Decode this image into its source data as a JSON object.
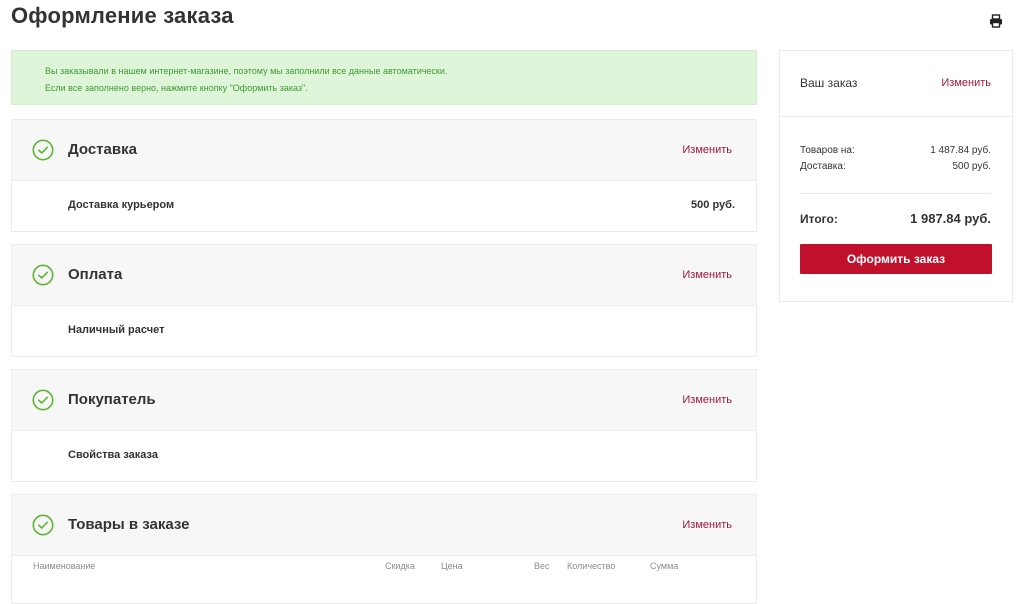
{
  "page": {
    "title": "Оформление заказа"
  },
  "icons": {
    "print": "printer-icon",
    "check": "check-circle-icon"
  },
  "colors": {
    "accent": "#c0102c",
    "link": "#a0183a",
    "success": "#5cb531",
    "notice_bg": "#dff5d9"
  },
  "notice": {
    "line1": "Вы заказывали в нашем интернет-магазине, поэтому мы заполнили все данные автоматически.",
    "line2": "Если все заполнено верно, нажмите кнопку \"Оформить заказ\"."
  },
  "sections": {
    "delivery": {
      "title": "Доставка",
      "edit": "Изменить",
      "item": "Доставка курьером",
      "price": "500 руб."
    },
    "payment": {
      "title": "Оплата",
      "edit": "Изменить",
      "item": "Наличный расчет"
    },
    "buyer": {
      "title": "Покупатель",
      "edit": "Изменить",
      "item": "Свойства заказа"
    },
    "items": {
      "title": "Товары в заказе",
      "edit": "Изменить",
      "columns": {
        "name": "Наименование",
        "discount": "Скидка",
        "price": "Цена",
        "weight": "Вес",
        "quantity": "Количество",
        "sum": "Сумма"
      }
    }
  },
  "summary": {
    "title": "Ваш заказ",
    "edit": "Изменить",
    "goods_label": "Товаров на:",
    "goods_value": "1 487.84 руб.",
    "delivery_label": "Доставка:",
    "delivery_value": "500 руб.",
    "total_label": "Итого:",
    "total_value": "1 987.84 руб.",
    "checkout_button": "Оформить заказ"
  }
}
